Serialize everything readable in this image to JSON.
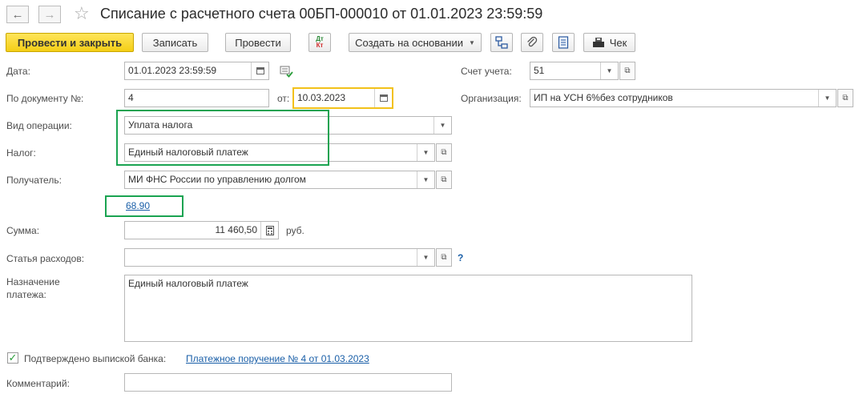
{
  "header": {
    "back_glyph": "←",
    "forward_glyph": "→",
    "star_glyph": "☆",
    "title": "Списание с расчетного счета 00БП-000010 от 01.01.2023 23:59:59"
  },
  "toolbar": {
    "post_close": "Провести и закрыть",
    "save": "Записать",
    "post": "Провести",
    "dtkt_top": "Дт",
    "dtkt_bottom": "Кт",
    "create_based": "Создать на основании",
    "check": "Чек"
  },
  "form": {
    "date_label": "Дата:",
    "date_value": "01.01.2023 23:59:59",
    "docnum_label": "По документу №:",
    "docnum_value": "4",
    "from_label": "от:",
    "from_value": "10.03.2023",
    "operation_label": "Вид операции:",
    "operation_value": "Уплата налога",
    "tax_label": "Налог:",
    "tax_value": "Единый налоговый платеж",
    "recipient_label": "Получатель:",
    "recipient_value": "МИ ФНС России по управлению долгом",
    "account_link": "68.90",
    "sum_label": "Сумма:",
    "sum_value": "11 460,50",
    "currency": "руб.",
    "expense_label": "Статья расходов:",
    "expense_value": "",
    "help_glyph": "?",
    "purpose_label_line1": "Назначение",
    "purpose_label_line2": "платежа:",
    "purpose_value": "Единый налоговый платеж",
    "confirmed_label": "Подтверждено выпиской банка:",
    "confirmed_checked": true,
    "payment_link": "Платежное поручение № 4 от 01.03.2023",
    "comment_label": "Комментарий:",
    "comment_value": "",
    "account_label": "Счет учета:",
    "account_value": "51",
    "org_label": "Организация:",
    "org_value": "ИП на УСН 6%без сотрудников"
  },
  "colors": {
    "primary_button": "#f4cf16",
    "highlight_green": "#1aa351",
    "highlight_yellow": "#f2c11a",
    "link": "#1a5fa8"
  }
}
